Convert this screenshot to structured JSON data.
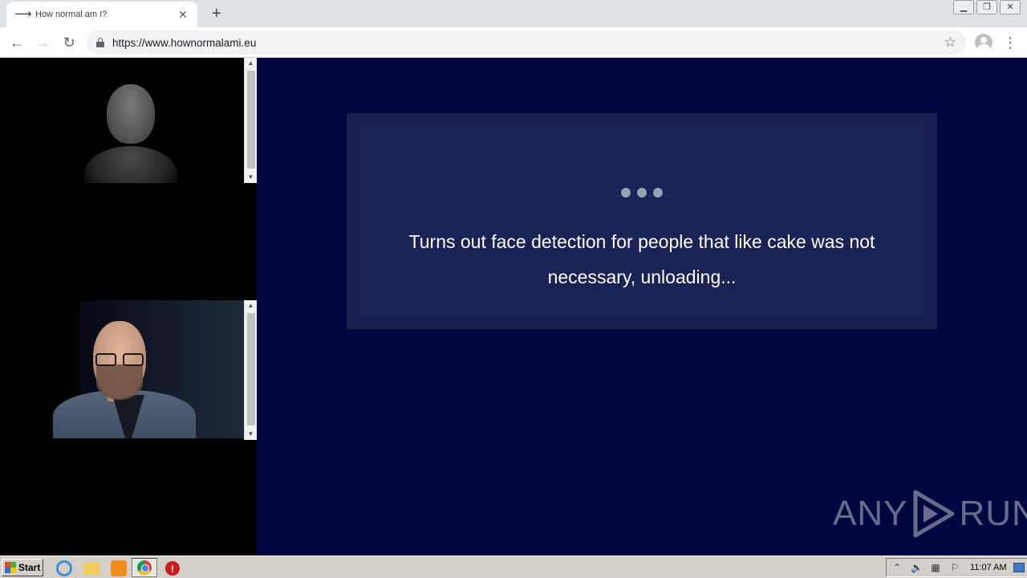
{
  "browser": {
    "tab_title": "How normal am I?",
    "tab_favicon": "arrow-right-icon",
    "url": "https://www.hownormalami.eu"
  },
  "page": {
    "message": "Turns out face detection for people that like cake was not necessary, unloading...",
    "watermark_left": "ANY",
    "watermark_right": "RUN",
    "colors": {
      "background": "#000640",
      "message_box": "#181f4d",
      "left_panel": "#000000"
    }
  },
  "taskbar": {
    "start_label": "Start",
    "clock": "11:07 AM"
  }
}
